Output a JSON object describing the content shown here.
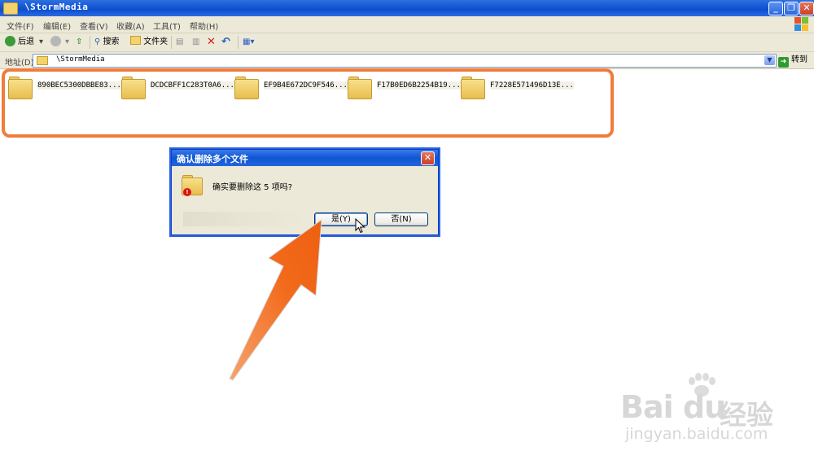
{
  "window": {
    "title": "\\StormMedia",
    "buttons": {
      "minimize": "_",
      "restore": "❐",
      "close": "✕"
    }
  },
  "menu": [
    "文件(F)",
    "编辑(E)",
    "查看(V)",
    "收藏(A)",
    "工具(T)",
    "帮助(H)"
  ],
  "toolbar": {
    "back": "后退",
    "search": "搜索",
    "folders": "文件夹"
  },
  "address": {
    "label": "地址(D)",
    "value": "\\StormMedia",
    "go": "转到"
  },
  "folders": [
    "890BEC5300DBBE83...",
    "DCDCBFF1C283T0A6...",
    "EF9B4E672DC9F546...",
    "F17B0ED6B2254B19...",
    "F7228E571496D13E..."
  ],
  "dialog": {
    "title": "确认删除多个文件",
    "message": "确实要删除这 5 项吗?",
    "yes": "是(Y)",
    "no": "否(N)"
  },
  "watermark": {
    "brand": "Bai  du",
    "cn": "经验",
    "url": "jingyan.baidu.com"
  },
  "colors": {
    "highlight": "#f07c3b",
    "titlebar": "#0b4fd0",
    "arrow": "#f26a1b"
  }
}
